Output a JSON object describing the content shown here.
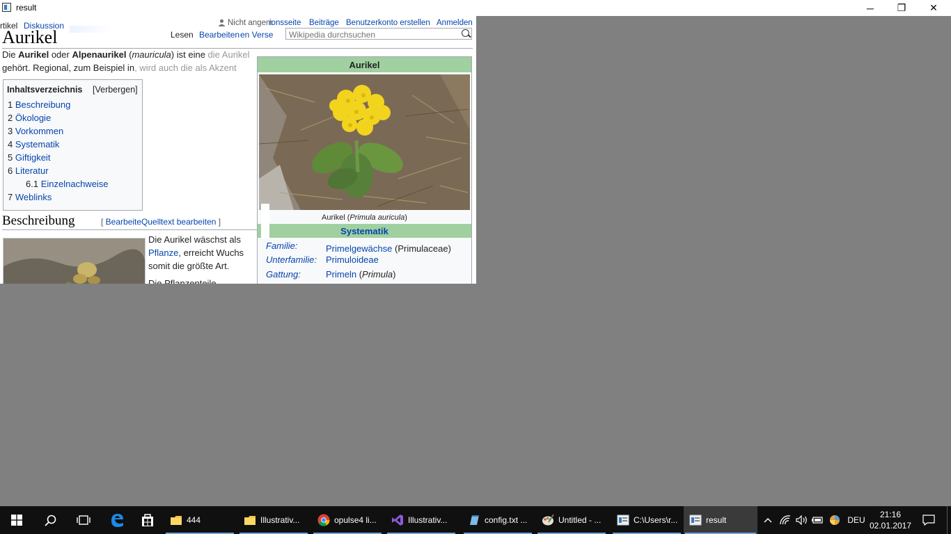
{
  "window": {
    "title": "result",
    "minimize": "─",
    "maximize": "❐",
    "close": "✕"
  },
  "wiki": {
    "tabs_left": {
      "article": "rtikel",
      "discussion": "Diskussion"
    },
    "user_links": {
      "not_logged": "Nicht angem",
      "talk": "ionsseite",
      "contrib": "Beiträge",
      "create": "Benutzerkonto erstellen",
      "login": "Anmelden"
    },
    "tabs_right": {
      "read": "Lesen",
      "edit": "Bearbeiten",
      "history": "en Verse"
    },
    "search": {
      "placeholder": "Wikipedia durchsuchen"
    },
    "heading": "Aurikel",
    "intro": {
      "l1_a": "Die ",
      "l1_b": "Aurikel",
      "l1_c": " oder ",
      "l1_d": "Alpenaurikel",
      "l1_e": " (",
      "l1_f": "mauricula",
      "l1_g": ") ist eine",
      "l1_h": " die Aurikel",
      "l2": "gehört. Regional, zum Beispiel in",
      "l2b": ", wird auch die als Akzent"
    },
    "toc": {
      "title": "Inhaltsverzeichnis",
      "hide": "[Verbergen]",
      "items": [
        {
          "num": "1",
          "label": "Beschreibung"
        },
        {
          "num": "2",
          "label": "Ökologie"
        },
        {
          "num": "3",
          "label": "Vorkommen"
        },
        {
          "num": "4",
          "label": "Systematik"
        },
        {
          "num": "5",
          "label": "Giftigkeit"
        },
        {
          "num": "6",
          "label": "Literatur"
        },
        {
          "num": "6.1",
          "label": "Einzelnachweise"
        },
        {
          "num": "7",
          "label": "Weblinks"
        }
      ]
    },
    "section": {
      "title": "Beschreibung",
      "edit_open": "[ ",
      "edit": "Bearbeite",
      "edit2": "Quelltext bearbeiten",
      "edit_close": " ]"
    },
    "body": {
      "l1": "Die Aurikel wäschst als",
      "l2a": "Pflanze",
      "l2b": ", erreicht Wuchs",
      "l3": "somit die größte Art.",
      "l4": "Die Pflanzenteile"
    },
    "infobox": {
      "title": "Aurikel",
      "caption_a": "Aurikel (",
      "caption_b": "Primula auricula",
      "caption_c": ")",
      "systematik": "Systematik",
      "rows": [
        {
          "key": "Familie:",
          "val": "Primelgewächse",
          "extra": " (Primulaceae)"
        },
        {
          "key": "Unterfamilie:",
          "val": "Primuloideae",
          "extra": ""
        },
        {
          "key": "Gattung:",
          "val": "Primeln",
          "extra_a": " (",
          "extra_b": "Primula",
          "extra_c": ")"
        }
      ]
    }
  },
  "taskbar": {
    "items": [
      {
        "label": "444",
        "icon": "folder-icon"
      },
      {
        "label": "Illustrativ...",
        "icon": "folder-icon"
      },
      {
        "label": "opulse4 li...",
        "icon": "chrome-icon"
      },
      {
        "label": "Illustrativ...",
        "icon": "visual-studio-icon"
      },
      {
        "label": "config.txt ...",
        "icon": "notepad-icon"
      },
      {
        "label": "Untitled - ...",
        "icon": "paint-icon"
      },
      {
        "label": "C:\\Users\\r...",
        "icon": "window-icon"
      },
      {
        "label": "result",
        "icon": "window-icon"
      }
    ],
    "lang": "DEU",
    "time": "21:16",
    "date": "02.01.2017"
  },
  "colors": {
    "link": "#0645ad",
    "infobox_header": "#a0d0a0",
    "taskbar": "#101010",
    "desktop": "#808080"
  }
}
